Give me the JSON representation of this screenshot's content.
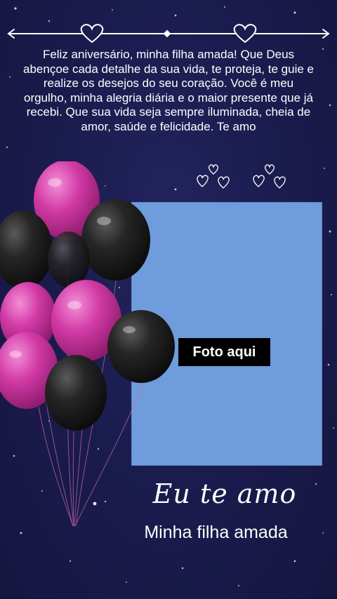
{
  "message": "Feliz aniversário, minha filha amada! Que Deus abençoe cada detalhe da sua vida, te proteja, te guie e realize os desejos do seu coração. Você é meu orgulho, minha alegria diária e o maior presente que já recebi. Que sua vida seja sempre iluminada, cheia de amor, saúde e felicidade. Te amo",
  "photo_placeholder": "Foto aqui",
  "script_title": "Eu te amo",
  "subtitle": "Minha filha amada",
  "colors": {
    "background": "#1b1c4f",
    "photo_frame": "#6f9cdc",
    "balloon_pink": "#d23aa6",
    "balloon_black": "#1c1c1c",
    "text": "#ffffff"
  },
  "icons": [
    "heart-divider-icon",
    "small-hearts-icon",
    "balloons-illustration"
  ]
}
